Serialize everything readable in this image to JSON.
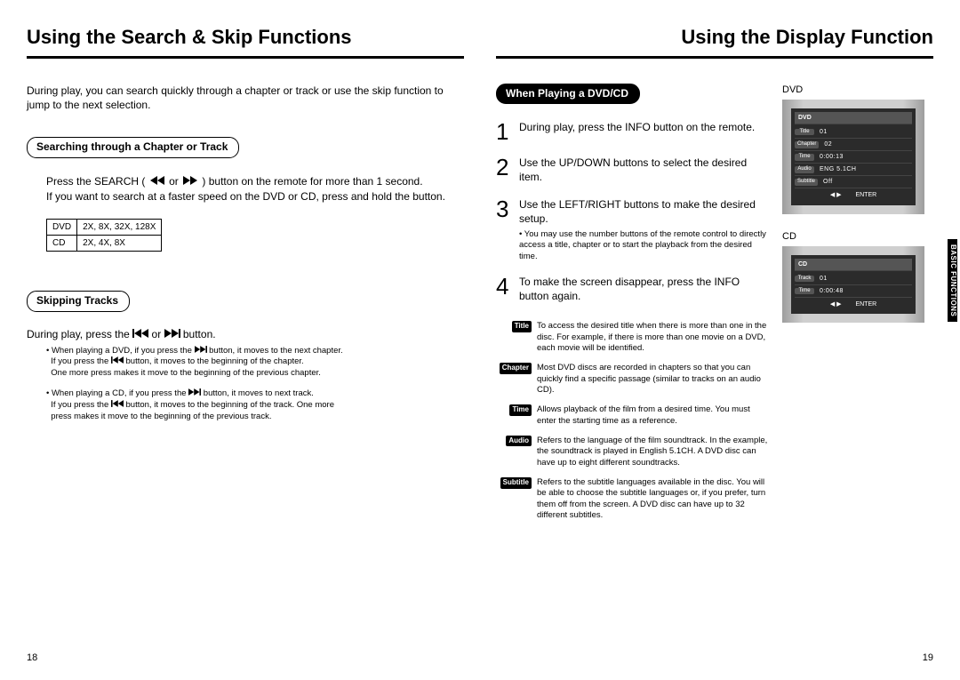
{
  "left": {
    "title": "Using the Search & Skip Functions",
    "intro": "During play, you can search quickly through a chapter or track or use the skip function to jump to the next selection.",
    "search_section_label": "Searching through a Chapter or Track",
    "search_body_1": "Press the SEARCH (",
    "search_body_or": " or ",
    "search_body_2": ") button on the remote for more than 1 second.",
    "search_body_3": "If you want to search at a faster speed on the DVD or CD, press and hold the button.",
    "table": {
      "r1c1": "DVD",
      "r1c2": "2X, 8X, 32X, 128X",
      "r2c1": "CD",
      "r2c2": "2X, 4X, 8X"
    },
    "skip_section_label": "Skipping Tracks",
    "skip_body_1": "During play, press the ",
    "skip_body_or": " or ",
    "skip_body_2": " button.",
    "skip_note1_a": "When playing a DVD, if you press the ",
    "skip_note1_b": " button, it moves to the next chapter.",
    "skip_note1_c": "If you press the ",
    "skip_note1_d": " button, it moves to the beginning of the chapter.",
    "skip_note1_e": "One more press makes it move to the beginning of the previous chapter.",
    "skip_note2_a": "When playing a CD, if you press the ",
    "skip_note2_b": " button, it moves to next track.",
    "skip_note2_c": "If you press the ",
    "skip_note2_d": " button, it moves to the beginning of the track. One more",
    "skip_note2_e": "press makes it move to the beginning of the previous track.",
    "page_num": "18"
  },
  "right": {
    "title": "Using the Display Function",
    "section_label": "When Playing a DVD/CD",
    "step1": "During play, press the INFO button on the remote.",
    "step2": "Use the UP/DOWN buttons to select the desired item.",
    "step3": "Use the LEFT/RIGHT buttons to make the desired setup.",
    "step3_note": "You may use the number buttons of the remote control to directly access a title, chapter or to start the playback from the desired time.",
    "step4": "To make the screen disappear, press the INFO button again.",
    "defs": {
      "title_label": "Title",
      "title_text": "To access the desired title when there is more than one in the disc. For example, if there is more than one movie on a DVD, each movie will be identified.",
      "chapter_label": "Chapter",
      "chapter_text": "Most DVD discs are recorded in chapters so that you can quickly find a specific passage (similar to tracks on an audio CD).",
      "time_label": "Time",
      "time_text": "Allows playback of the film from a desired time. You must enter the starting time as a reference.",
      "audio_label": "Audio",
      "audio_text": "Refers to the language of the film soundtrack. In the example, the soundtrack is played in English 5.1CH. A DVD disc can have up to eight different soundtracks.",
      "subtitle_label": "Subtitle",
      "subtitle_text": "Refers to the subtitle languages available in the disc. You will be able to choose the subtitle languages or, if you prefer, turn them off from the screen. A DVD disc can have up to 32 different subtitles."
    },
    "dvd_label": "DVD",
    "cd_label": "CD",
    "dvd_panel": {
      "header": "DVD",
      "title_lab": "Title",
      "title_val": "01",
      "chap_lab": "Chapter",
      "chap_val": "02",
      "time_lab": "Time",
      "time_val": "0:00:13",
      "audio_lab": "Audio",
      "audio_val": "ENG 5.1CH",
      "sub_lab": "Subtitle",
      "sub_val": "Off",
      "enter": "ENTER"
    },
    "cd_panel": {
      "header": "CD",
      "track_lab": "Track",
      "track_val": "01",
      "time_lab": "Time",
      "time_val": "0:00:48",
      "enter": "ENTER"
    },
    "side_tab": "BASIC FUNCTIONS",
    "page_num": "19"
  }
}
